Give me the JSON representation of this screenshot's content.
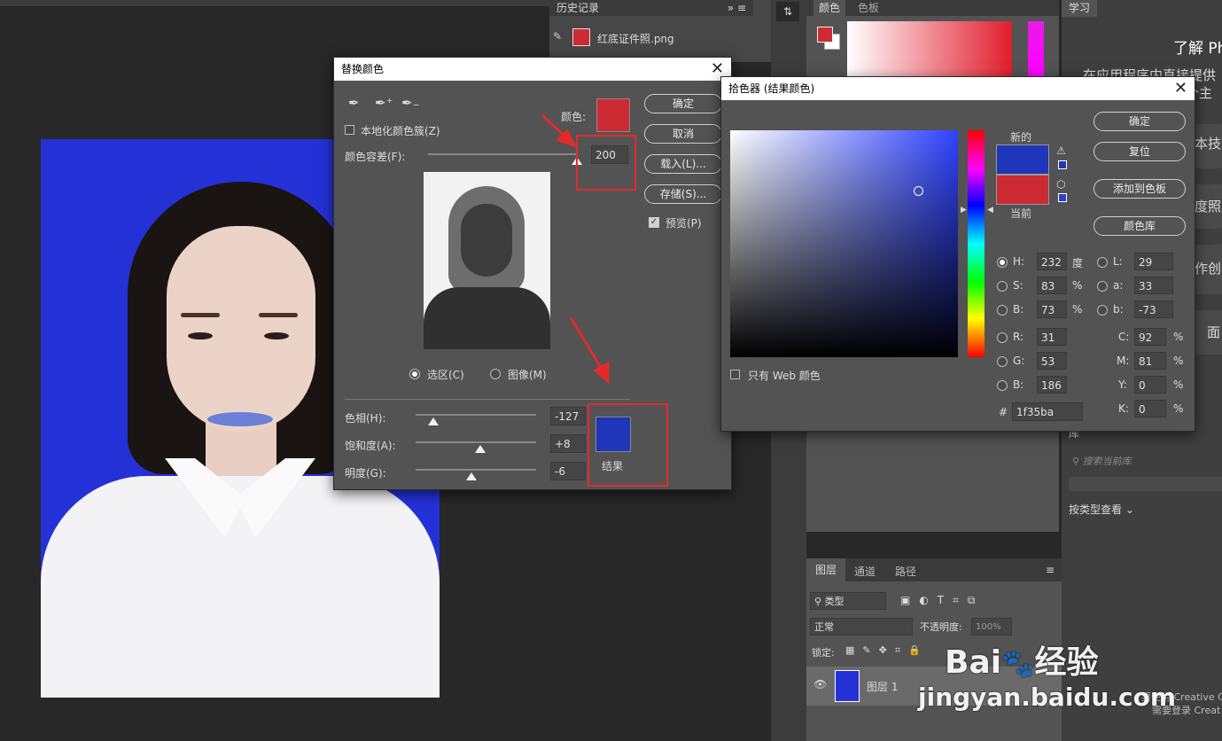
{
  "history_panel": {
    "tab": "历史记录",
    "item": "红底证件照.png"
  },
  "color_panel": {
    "tabs": [
      "颜色",
      "色板"
    ]
  },
  "learn_panel": {
    "tab": "学习",
    "heading": "了解 Ph",
    "line1": "在应用程序内直接提供",
    "line2": "个主",
    "frag1": "本技能",
    "frag2": "度照片",
    "frag3": "作创意",
    "frag4": "面",
    "library_tab": "库",
    "search_placeholder": "搜索当前库",
    "view_by_type": "按类型查看",
    "footer1": "要使用 Creative C",
    "footer2": "需要登录 Creat"
  },
  "layers_panel": {
    "tabs": [
      "图层",
      "通道",
      "路径"
    ],
    "filter": "类型",
    "blend_mode": "正常",
    "opacity_label": "不透明度:",
    "opacity_value": "100%",
    "lock_label": "锁定:",
    "layer_name": "图层 1"
  },
  "replace_dialog": {
    "title": "替换颜色",
    "localized_label": "本地化颜色簇(Z)",
    "color_label": "颜色:",
    "fuzziness_label": "颜色容差(F):",
    "fuzziness_value": "200",
    "ok": "确定",
    "cancel": "取消",
    "load": "载入(L)...",
    "save": "存储(S)...",
    "preview": "预览(P)",
    "selection": "选区(C)",
    "image": "图像(M)",
    "hue_label": "色相(H):",
    "hue_value": "-127",
    "sat_label": "饱和度(A):",
    "sat_value": "+8",
    "light_label": "明度(G):",
    "light_value": "-6",
    "result_label": "结果",
    "source_color": "#cc2b34",
    "result_color": "#1f35ba"
  },
  "picker_dialog": {
    "title": "拾色器 (结果颜色)",
    "ok": "确定",
    "reset": "复位",
    "add_swatch": "添加到色板",
    "color_lib": "颜色库",
    "new_label": "新的",
    "current_label": "当前",
    "web_only": "只有 Web 颜色",
    "H": "232",
    "H_unit": "度",
    "S": "83",
    "S_unit": "%",
    "Bv": "73",
    "B_unit": "%",
    "R": "31",
    "G": "53",
    "Bc": "186",
    "L": "29",
    "a": "33",
    "b": "-73",
    "C": "92",
    "M": "81",
    "Y": "0",
    "K": "0",
    "hex": "1f35ba",
    "hsb_labels": [
      "H:",
      "S:",
      "B:"
    ],
    "rgb_labels": [
      "R:",
      "G:",
      "B:"
    ],
    "lab_labels": [
      "L:",
      "a:",
      "b:"
    ],
    "cmyk_labels": [
      "C:",
      "M:",
      "Y:",
      "K:"
    ],
    "pct": "%",
    "hash": "#",
    "new_color": "#1f35ba",
    "current_color": "#cc2b34"
  },
  "watermark": {
    "brand_a": "Bai",
    "brand_b": "经验",
    "url": "jingyan.baidu.com"
  }
}
